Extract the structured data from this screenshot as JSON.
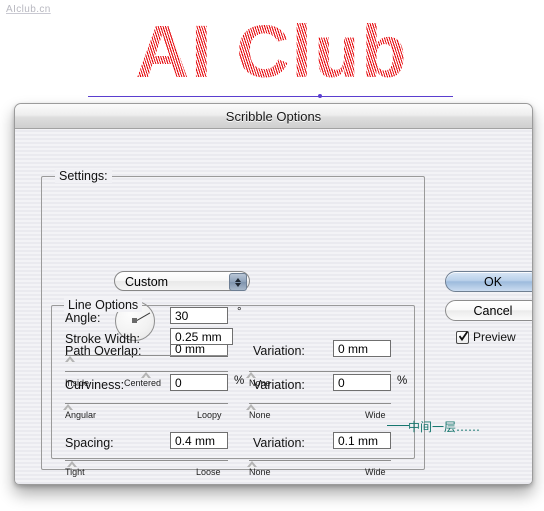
{
  "artwork": {
    "watermark": "AIclub.cn",
    "title_text": "AI Club",
    "title_color": "#e60d11",
    "path_color": "#5b3fd0"
  },
  "dialog": {
    "title": "Scribble Options",
    "settings": {
      "label": "Settings:",
      "value": "Custom",
      "stepper_up_icon": "caret-up-icon",
      "stepper_down_icon": "caret-down-icon"
    },
    "angle": {
      "label": "Angle:",
      "value": "30",
      "unit": "°",
      "dial_icon": "angle-dial-icon",
      "degrees": 30
    },
    "path_overlap": {
      "label": "Path Overlap:",
      "value": "0 mm",
      "slider": {
        "min_label": "Inside",
        "mid_label": "Centered",
        "max_label": "Outside",
        "position_pct": 50
      },
      "variation": {
        "label": "Variation:",
        "value": "0 mm",
        "slider": {
          "min_label": "None",
          "max_label": "Wide",
          "position_pct": 0
        }
      }
    },
    "line_options": {
      "legend": "Line Options",
      "stroke_width": {
        "label": "Stroke Width:",
        "value": "0.25 mm",
        "slider": {
          "position_pct": 2
        }
      },
      "curviness": {
        "label": "Curviness:",
        "value": "0",
        "unit": "%",
        "slider": {
          "min_label": "Angular",
          "max_label": "Loopy",
          "position_pct": 0
        },
        "variation": {
          "label": "Variation:",
          "value": "0",
          "unit": "%",
          "slider": {
            "min_label": "None",
            "max_label": "Wide",
            "position_pct": 0
          }
        }
      },
      "spacing": {
        "label": "Spacing:",
        "value": "0.4 mm",
        "slider": {
          "min_label": "Tight",
          "max_label": "Loose",
          "position_pct": 6
        },
        "variation": {
          "label": "Variation:",
          "value": "0.1 mm",
          "slider": {
            "min_label": "None",
            "max_label": "Wide",
            "position_pct": 3
          }
        }
      }
    },
    "buttons": {
      "ok": "OK",
      "cancel": "Cancel",
      "preview_label": "Preview",
      "preview_checked": true,
      "check_icon": "checkmark-icon"
    },
    "annotation": {
      "text": "中间一层……",
      "color": "#17776f"
    }
  }
}
